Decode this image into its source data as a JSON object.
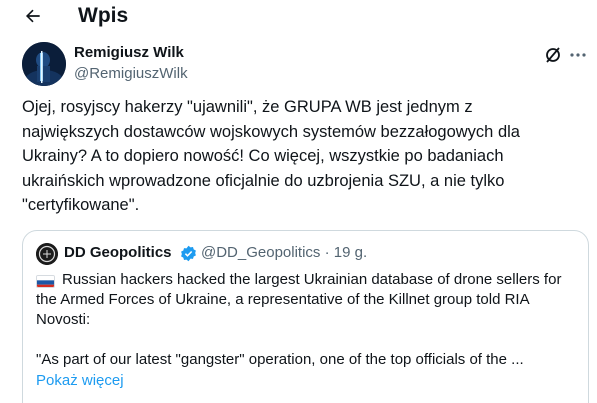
{
  "header": {
    "title": "Wpis",
    "back_icon": "arrow-left-icon"
  },
  "author": {
    "name": "Remigiusz Wilk",
    "handle": "@RemigiuszWilk",
    "avatar_icon": "user-avatar"
  },
  "actions": {
    "grok_icon": "grok-icon",
    "more_icon": "more-horizontal-icon"
  },
  "tweet": {
    "text": "Ojej, rosyjscy hakerzy \"ujawnili\", że GRUPA WB jest jednym z\nnajwiększych dostawców wojskowych systemów bezzałogowych dla\nUkrainy? A to dopiero nowość! Co więcej, wszystkie po badaniach\nukraińskich wprowadzone oficjalnie do uzbrojenia SZU, a nie tylko\n\"certyfikowane\"."
  },
  "quote": {
    "name": "DD Geopolitics",
    "handle": "@DD_Geopolitics",
    "separator": "·",
    "time": "19 g.",
    "verified_icon": "verified-badge-icon",
    "flag_icon": "russia-flag-icon",
    "text": "Russian hackers hacked the largest Ukrainian database of drone sellers for the Armed Forces of Ukraine, a representative of the Killnet group told RIA Novosti:",
    "text2": "\"As part of our latest \"gangster\" operation, one of the top officials of the ...",
    "show_more": "Pokaż więcej"
  },
  "colors": {
    "text": "#0f1419",
    "secondary": "#536471",
    "link": "#1d9bf0",
    "border": "#cfd9de"
  }
}
